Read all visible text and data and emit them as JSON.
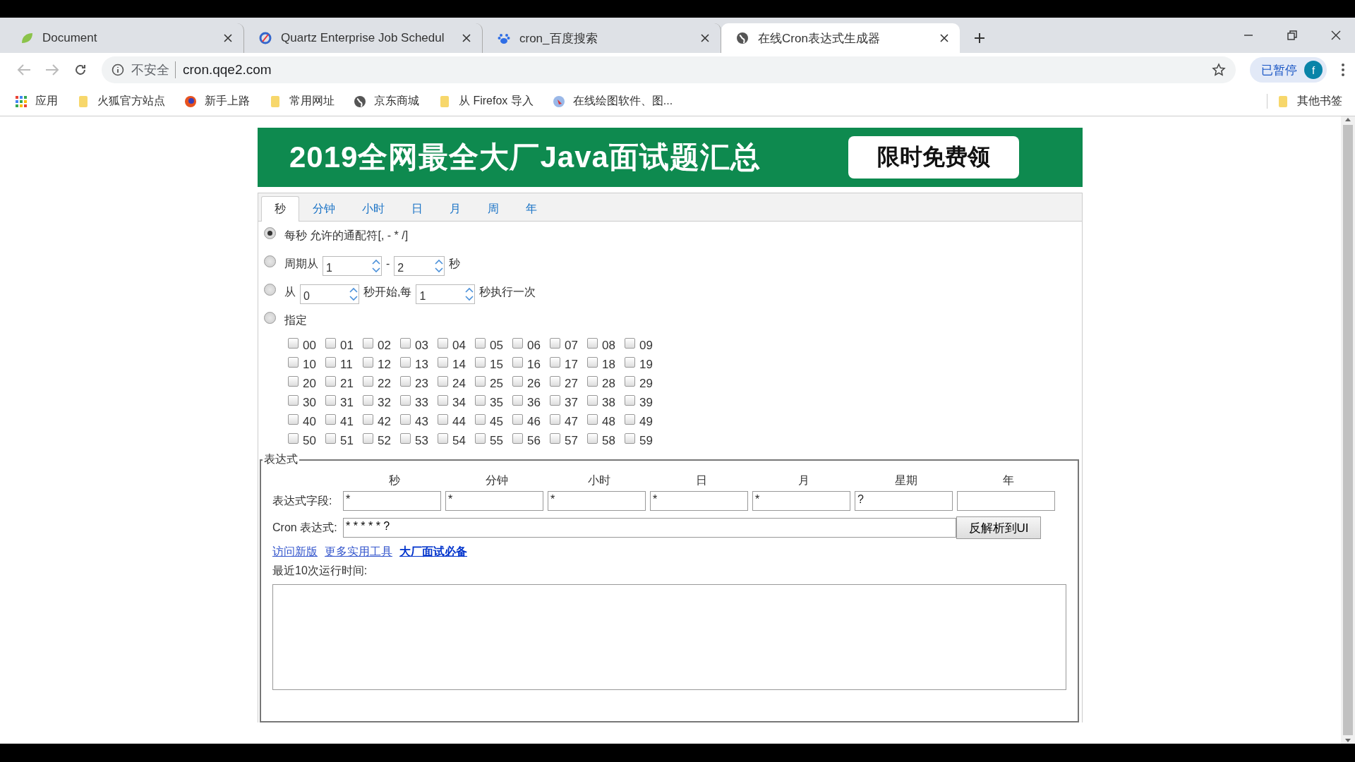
{
  "browser_tabs": [
    {
      "title": "Document",
      "selected": false,
      "kind": "leaf"
    },
    {
      "title": "Quartz Enterprise Job Schedul",
      "selected": false,
      "kind": "ring"
    },
    {
      "title": "cron_百度搜索",
      "selected": false,
      "kind": "paw"
    },
    {
      "title": "在线Cron表达式生成器",
      "selected": true,
      "kind": "globe"
    }
  ],
  "address_bar": {
    "security": "不安全",
    "url": "cron.qqe2.com"
  },
  "profile": {
    "status": "已暂停",
    "avatar": "f"
  },
  "bookmarks": [
    {
      "label": "应用",
      "kind": "apps"
    },
    {
      "label": "火狐官方站点",
      "kind": "folder"
    },
    {
      "label": "新手上路",
      "kind": "fox"
    },
    {
      "label": "常用网址",
      "kind": "folder"
    },
    {
      "label": "京东商城",
      "kind": "globe"
    },
    {
      "label": "从 Firefox 导入",
      "kind": "folder"
    },
    {
      "label": "在线绘图软件、图...",
      "kind": "draw"
    }
  ],
  "other_bookmarks": "其他书签",
  "banner": {
    "title": "2019全网最全大厂Java面试题汇总",
    "button": "限时免费领"
  },
  "tabs": [
    {
      "label": "秒",
      "selected": true
    },
    {
      "label": "分钟",
      "selected": false
    },
    {
      "label": "小时",
      "selected": false
    },
    {
      "label": "日",
      "selected": false
    },
    {
      "label": "月",
      "selected": false
    },
    {
      "label": "周",
      "selected": false
    },
    {
      "label": "年",
      "selected": false
    }
  ],
  "options": [
    {
      "kind": "text",
      "selected": true,
      "parts": [
        "每秒 允许的通配符[, - * /]"
      ]
    },
    {
      "kind": "range",
      "selected": false,
      "parts": [
        "周期从",
        "1",
        "-",
        "2",
        "秒"
      ]
    },
    {
      "kind": "range",
      "selected": false,
      "parts": [
        "从",
        "0",
        "秒开始,每",
        "1",
        "秒执行一次"
      ]
    },
    {
      "kind": "text",
      "selected": false,
      "parts": [
        "指定"
      ]
    }
  ],
  "seconds": [
    {
      "label": "00",
      "checked": false
    },
    {
      "label": "01",
      "checked": false
    },
    {
      "label": "02",
      "checked": false
    },
    {
      "label": "03",
      "checked": false
    },
    {
      "label": "04",
      "checked": false
    },
    {
      "label": "05",
      "checked": false
    },
    {
      "label": "06",
      "checked": false
    },
    {
      "label": "07",
      "checked": false
    },
    {
      "label": "08",
      "checked": false
    },
    {
      "label": "09",
      "checked": false
    },
    {
      "label": "10",
      "checked": false
    },
    {
      "label": "11",
      "checked": false
    },
    {
      "label": "12",
      "checked": false
    },
    {
      "label": "13",
      "checked": false
    },
    {
      "label": "14",
      "checked": false
    },
    {
      "label": "15",
      "checked": false
    },
    {
      "label": "16",
      "checked": false
    },
    {
      "label": "17",
      "checked": false
    },
    {
      "label": "18",
      "checked": false
    },
    {
      "label": "19",
      "checked": false
    },
    {
      "label": "20",
      "checked": false
    },
    {
      "label": "21",
      "checked": false
    },
    {
      "label": "22",
      "checked": false
    },
    {
      "label": "23",
      "checked": false
    },
    {
      "label": "24",
      "checked": false
    },
    {
      "label": "25",
      "checked": false
    },
    {
      "label": "26",
      "checked": false
    },
    {
      "label": "27",
      "checked": false
    },
    {
      "label": "28",
      "checked": false
    },
    {
      "label": "29",
      "checked": false
    },
    {
      "label": "30",
      "checked": false
    },
    {
      "label": "31",
      "checked": false
    },
    {
      "label": "32",
      "checked": false
    },
    {
      "label": "33",
      "checked": false
    },
    {
      "label": "34",
      "checked": false
    },
    {
      "label": "35",
      "checked": false
    },
    {
      "label": "36",
      "checked": false
    },
    {
      "label": "37",
      "checked": false
    },
    {
      "label": "38",
      "checked": false
    },
    {
      "label": "39",
      "checked": false
    },
    {
      "label": "40",
      "checked": false
    },
    {
      "label": "41",
      "checked": false
    },
    {
      "label": "42",
      "checked": false
    },
    {
      "label": "43",
      "checked": false
    },
    {
      "label": "44",
      "checked": false
    },
    {
      "label": "45",
      "checked": false
    },
    {
      "label": "46",
      "checked": false
    },
    {
      "label": "47",
      "checked": false
    },
    {
      "label": "48",
      "checked": false
    },
    {
      "label": "49",
      "checked": false
    },
    {
      "label": "50",
      "checked": false
    },
    {
      "label": "51",
      "checked": false
    },
    {
      "label": "52",
      "checked": false
    },
    {
      "label": "53",
      "checked": false
    },
    {
      "label": "54",
      "checked": false
    },
    {
      "label": "55",
      "checked": false
    },
    {
      "label": "56",
      "checked": false
    },
    {
      "label": "57",
      "checked": false
    },
    {
      "label": "58",
      "checked": false
    },
    {
      "label": "59",
      "checked": false
    }
  ],
  "expression": {
    "legend": "表达式",
    "columns": [
      "秒",
      "分钟",
      "小时",
      "日",
      "月",
      "星期",
      "年"
    ],
    "fields_label": "表达式字段:",
    "fields": [
      "*",
      "*",
      "*",
      "*",
      "*",
      "?"
    ],
    "cron_label": "Cron 表达式:",
    "cron_value": "* * * * * ?",
    "parse_button": "反解析到UI",
    "links": [
      "访问新版",
      "更多实用工具",
      "大厂面试必备"
    ],
    "recent_label": "最近10次运行时间:"
  }
}
